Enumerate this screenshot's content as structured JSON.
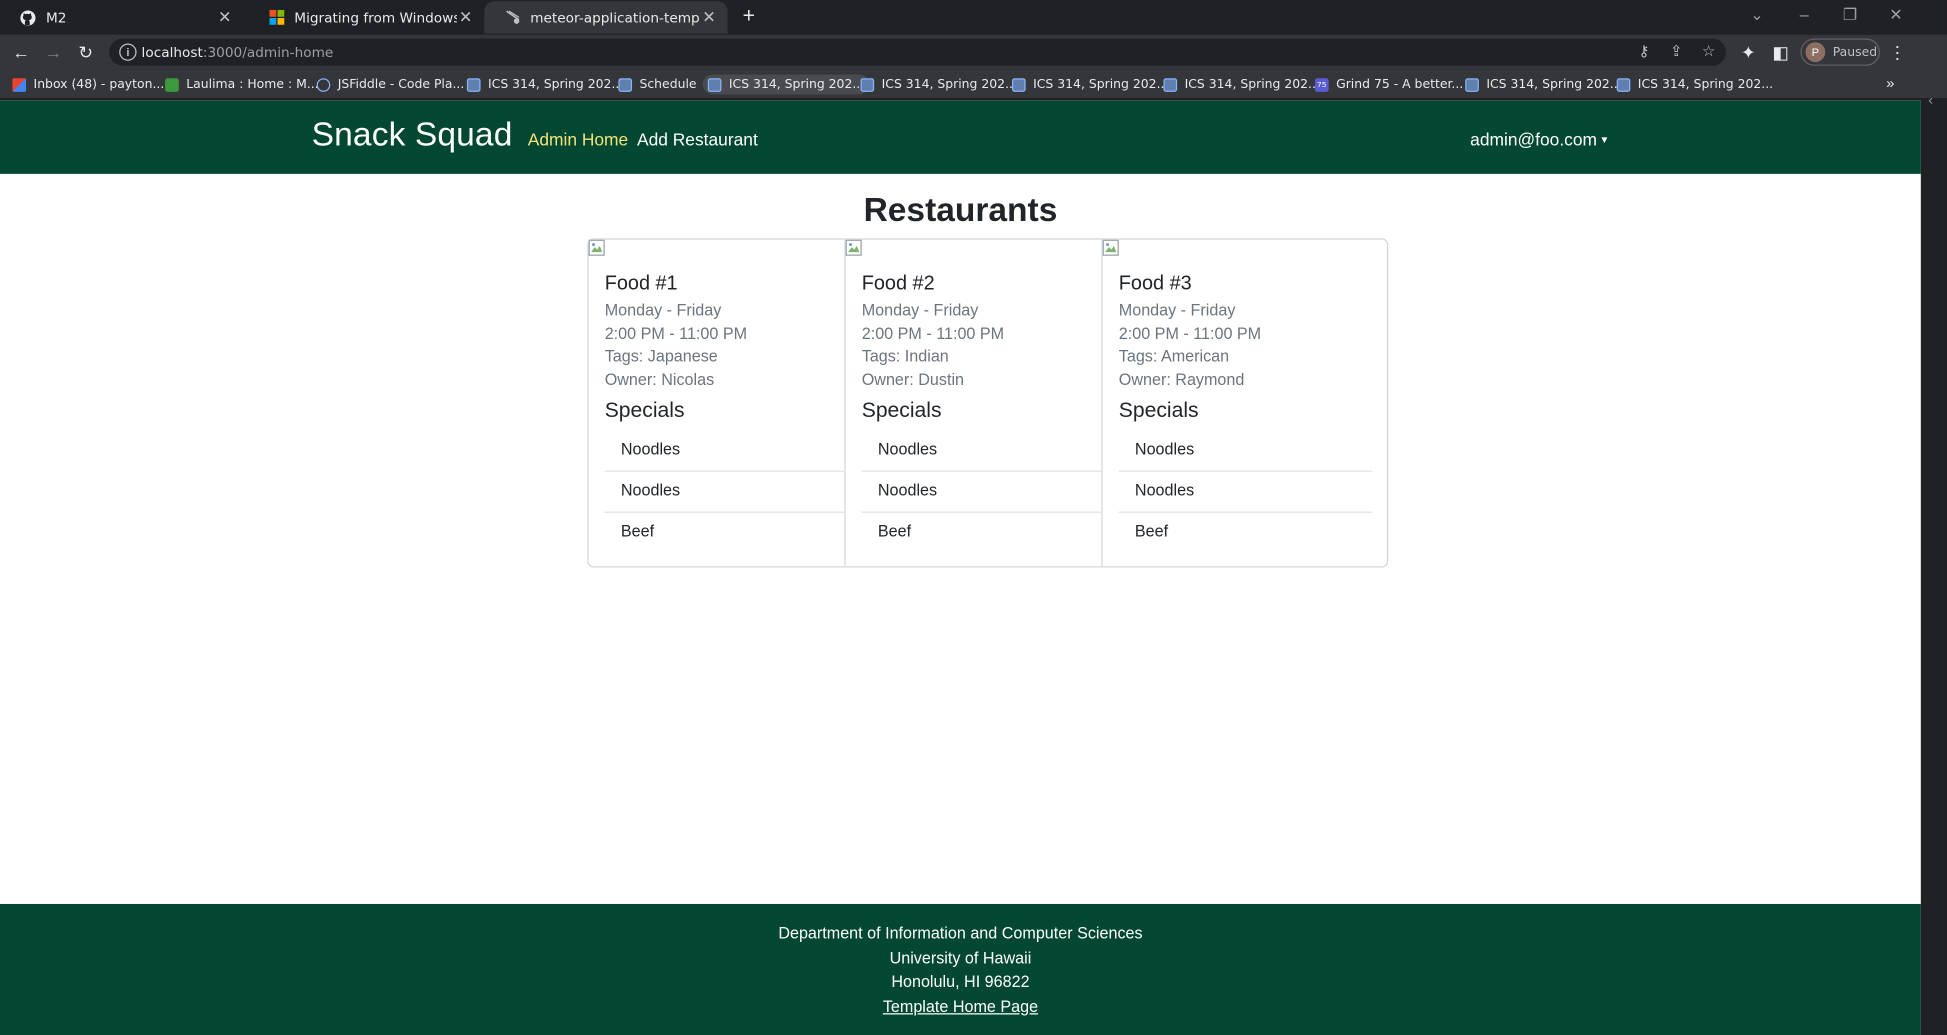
{
  "browser": {
    "tabs": [
      {
        "title": "M2",
        "favicon": "github-icon"
      },
      {
        "title": "Migrating from Windows PowerS",
        "favicon": "microsoft-icon"
      },
      {
        "title": "meteor-application-template-rea",
        "favicon": "meteor-icon"
      }
    ],
    "url_host": "localhost",
    "url_path": ":3000/admin-home",
    "profile_initial": "P",
    "profile_status": "Paused",
    "bookmarks": [
      "Inbox (48) - payton...",
      "Laulima : Home : M...",
      "JSFiddle - Code Pla...",
      "ICS 314, Spring 202...",
      "Schedule",
      "ICS 314, Spring 202...",
      "ICS 314, Spring 202...",
      "ICS 314, Spring 202...",
      "ICS 314, Spring 202...",
      "Grind 75 - A better...",
      "ICS 314, Spring 202...",
      "ICS 314, Spring 202..."
    ]
  },
  "navbar": {
    "brand": "Snack Squad",
    "admin_home": "Admin Home",
    "add_restaurant": "Add Restaurant",
    "user": "admin@foo.com"
  },
  "main": {
    "title": "Restaurants",
    "specials_heading": "Specials",
    "cards": [
      {
        "name": "Food #1",
        "days": "Monday - Friday",
        "hours": "2:00 PM - 11:00 PM",
        "tags": "Tags: Japanese",
        "owner": "Owner: Nicolas",
        "specials": [
          "Noodles",
          "Noodles",
          "Beef"
        ]
      },
      {
        "name": "Food #2",
        "days": "Monday - Friday",
        "hours": "2:00 PM - 11:00 PM",
        "tags": "Tags: Indian",
        "owner": "Owner: Dustin",
        "specials": [
          "Noodles",
          "Noodles",
          "Beef"
        ]
      },
      {
        "name": "Food #3",
        "days": "Monday - Friday",
        "hours": "2:00 PM - 11:00 PM",
        "tags": "Tags: American",
        "owner": "Owner: Raymond",
        "specials": [
          "Noodles",
          "Noodles",
          "Beef"
        ]
      }
    ]
  },
  "footer": {
    "line1": "Department of Information and Computer Sciences",
    "line2": "University of Hawaii",
    "line3": "Honolulu, HI 96822",
    "link": "Template Home Page"
  },
  "colors": {
    "navbar": "#024731",
    "active_link": "#f3e27a"
  }
}
